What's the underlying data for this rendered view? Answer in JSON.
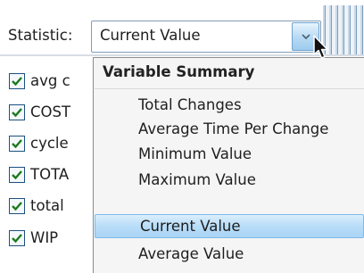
{
  "statistic": {
    "label": "Statistic:",
    "selected_value": "Current Value"
  },
  "variables": [
    {
      "label": "avg c",
      "checked": true
    },
    {
      "label": "COST",
      "checked": true
    },
    {
      "label": "cycle",
      "checked": true
    },
    {
      "label": "TOTA",
      "checked": true
    },
    {
      "label": "total",
      "checked": true
    },
    {
      "label": "WIP",
      "checked": true
    }
  ],
  "dropdown": {
    "header": "Variable Summary",
    "items": [
      {
        "label": "Total Changes"
      },
      {
        "label": "Average Time Per Change"
      },
      {
        "label": "Minimum Value"
      },
      {
        "label": "Maximum Value"
      },
      {
        "label": "Current Value",
        "selected": true
      },
      {
        "label": "Average Value"
      }
    ]
  },
  "colors": {
    "check": "#1c7a1c",
    "selected_highlight": "#b8ddf8",
    "menu_background": "#f5f5f5"
  },
  "icons": {
    "dropdown_arrow": "chevron-down-icon",
    "cursor": "mouse-pointer-icon",
    "checkbox_check": "checkmark-icon"
  }
}
